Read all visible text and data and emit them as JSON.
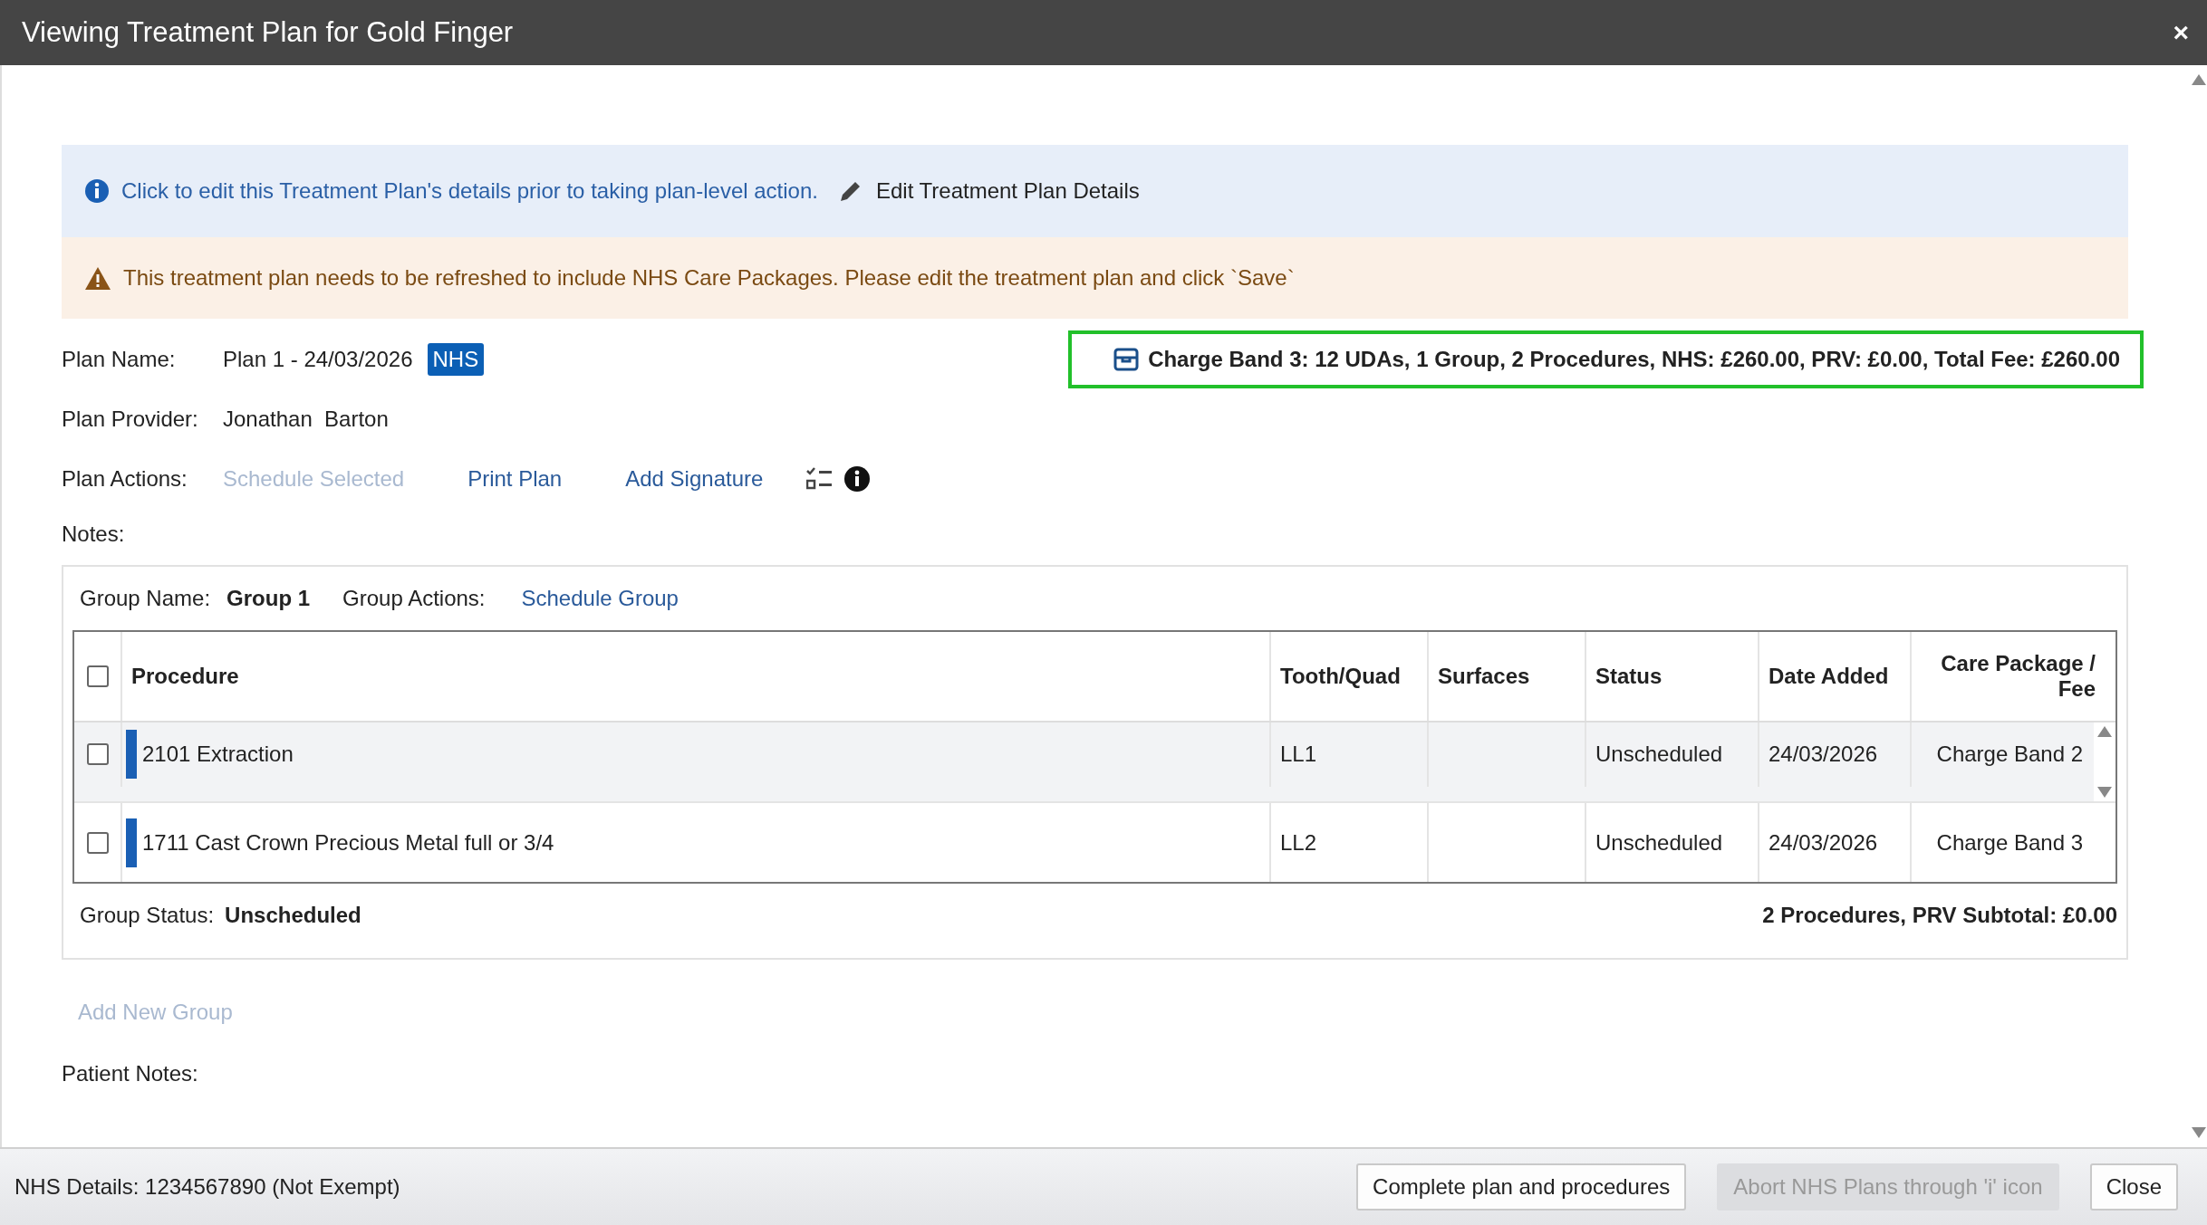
{
  "window": {
    "title": "Viewing Treatment Plan for Gold Finger",
    "close": "×"
  },
  "info_banner": {
    "text": "Click to edit this Treatment Plan's details prior to taking plan-level action.",
    "action": "Edit Treatment Plan Details"
  },
  "warning_banner": {
    "text": "This treatment plan needs to be refreshed to include NHS Care Packages. Please edit the treatment plan and click `Save`"
  },
  "plan": {
    "name_label": "Plan Name:",
    "name": "Plan 1 - 24/03/2026",
    "badge": "NHS",
    "provider_label": "Plan Provider:",
    "provider": "Jonathan  Barton",
    "actions_label": "Plan Actions:",
    "actions": [
      {
        "label": "Schedule Selected",
        "disabled": true
      },
      {
        "label": "Print Plan",
        "disabled": false
      },
      {
        "label": "Add Signature",
        "disabled": false
      }
    ],
    "notes_label": "Notes:"
  },
  "summary": "Charge Band 3: 12 UDAs, 1 Group, 2 Procedures, NHS: £260.00, PRV: £0.00, Total Fee: £260.00",
  "group": {
    "name_label": "Group Name:",
    "name": "Group 1",
    "actions_label": "Group Actions:",
    "action": "Schedule Group",
    "select_all_checked": false,
    "columns": [
      "Procedure",
      "Tooth/Quad",
      "Surfaces",
      "Status",
      "Date Added",
      "Care Package / Fee"
    ],
    "rows": [
      {
        "checked": false,
        "highlighted": true,
        "cells": [
          "2101 Extraction",
          "LL1",
          null,
          "Unscheduled",
          "24/03/2026",
          "Charge Band 2"
        ]
      },
      {
        "checked": false,
        "highlighted": false,
        "cells": [
          "1711 Cast Crown Precious Metal full or 3/4",
          "LL2",
          null,
          "Unscheduled",
          "24/03/2026",
          "Charge Band 3"
        ]
      }
    ],
    "status_label": "Group Status:",
    "status": "Unscheduled",
    "subtotal": "2 Procedures, PRV Subtotal: £0.00"
  },
  "add_group": {
    "label": "Add New Group",
    "disabled": true
  },
  "patient_notes_label": "Patient Notes:",
  "footer": {
    "nhs_details": "NHS Details: 1234567890 (Not Exempt)",
    "buttons": [
      {
        "label": "Complete plan and procedures",
        "disabled": false
      },
      {
        "label": "Abort NHS Plans through 'i' icon",
        "disabled": true
      },
      {
        "label": "Close",
        "disabled": false
      }
    ]
  }
}
